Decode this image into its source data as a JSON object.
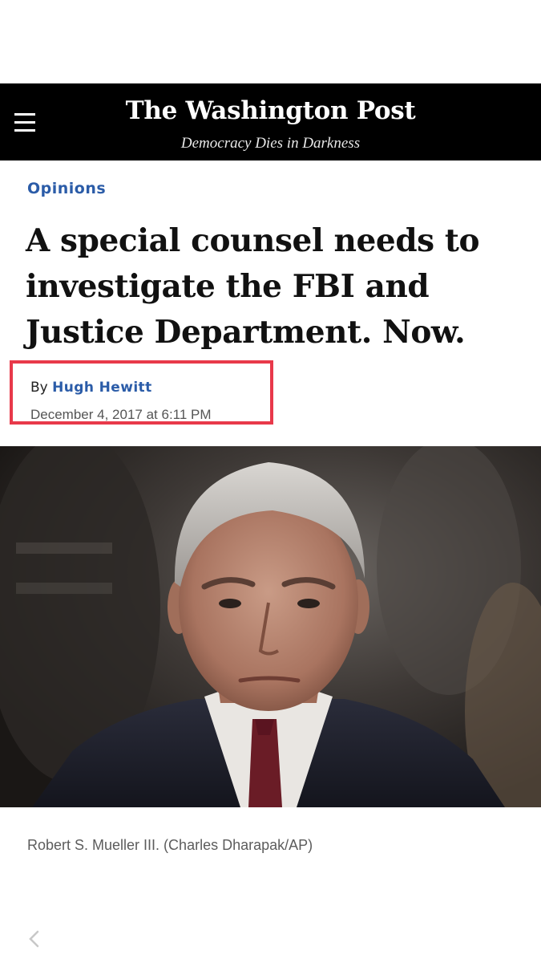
{
  "masthead": {
    "logo": "The Washington Post",
    "tagline": "Democracy Dies in Darkness",
    "menu_icon": "hamburger-menu-icon",
    "background": "#000000"
  },
  "article": {
    "section": "Opinions",
    "headline": "A special counsel needs to investigate the FBI and Justice Department. Now.",
    "byline_prefix": "By",
    "author": "Hugh Hewitt",
    "timestamp": "December 4, 2017 at 6:11 PM",
    "photo_caption": "Robert S. Mueller III. (Charles Dharapak/AP)"
  },
  "highlight": {
    "color": "#e8394a"
  },
  "colors": {
    "link_blue": "#2b5ca8",
    "headline": "#111111",
    "caption_gray": "#5c5c5c"
  },
  "nav": {
    "back_icon": "chevron-left-icon"
  }
}
